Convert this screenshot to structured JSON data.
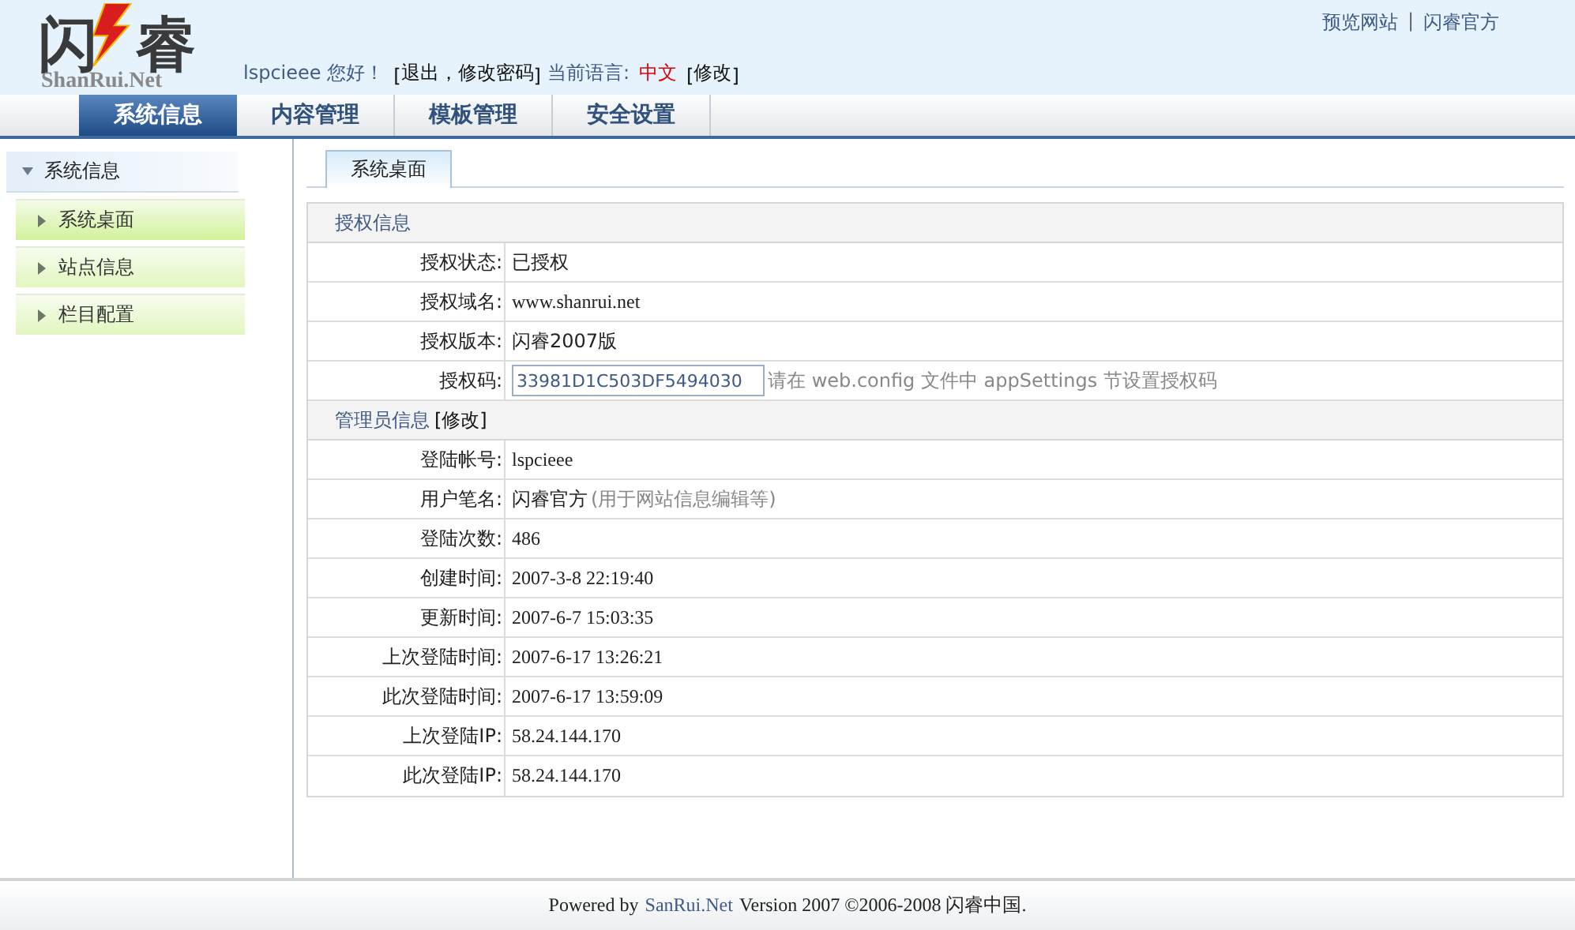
{
  "logo": {
    "mark": "闪睿",
    "caption": "ShanRui.Net"
  },
  "top_links": [
    {
      "kind": "link",
      "text": "预览网站"
    },
    {
      "kind": "sep",
      "text": "|"
    },
    {
      "kind": "link",
      "text": "闪睿官方"
    }
  ],
  "user_bar": [
    {
      "kind": "text",
      "text": "lspcieee 您好！"
    },
    {
      "kind": "plain",
      "text": "["
    },
    {
      "kind": "link",
      "text": "退出"
    },
    {
      "kind": "plain",
      "text": "，"
    },
    {
      "kind": "link",
      "text": "修改密码"
    },
    {
      "kind": "plain",
      "text": "]"
    },
    {
      "kind": "text",
      "text": "当前语言:"
    },
    {
      "kind": "lang",
      "text": "中文"
    },
    {
      "kind": "plain",
      "text": "["
    },
    {
      "kind": "link",
      "text": "修改"
    },
    {
      "kind": "plain",
      "text": "]"
    }
  ],
  "nav_tabs": [
    {
      "label": "系统信息",
      "selected": true
    },
    {
      "label": "内容管理",
      "selected": false
    },
    {
      "label": "模板管理",
      "selected": false
    },
    {
      "label": "安全设置",
      "selected": false
    }
  ],
  "sidebar": {
    "title": "系统信息",
    "expanded": true,
    "items": [
      {
        "label": "系统桌面",
        "selected": true
      },
      {
        "label": "站点信息",
        "selected": false
      },
      {
        "label": "栏目配置",
        "selected": false
      }
    ]
  },
  "content_tabs": [
    {
      "label": "系统桌面",
      "selected": true
    }
  ],
  "sections": [
    {
      "title": "授权信息",
      "rows": [
        {
          "kind": "text",
          "label": "授权状态:",
          "value": "已授权"
        },
        {
          "kind": "text",
          "label": "授权域名:",
          "value": "www.shanrui.net"
        },
        {
          "kind": "text",
          "label": "授权版本:",
          "value": "闪睿2007版"
        },
        {
          "kind": "input",
          "label": "授权码:",
          "value": "33981D1C503DF5494030",
          "note": "请在 web.config 文件中 appSettings 节设置授权码"
        }
      ]
    },
    {
      "title": "管理员信息",
      "link": "[修改]",
      "rows": [
        {
          "kind": "text",
          "label": "登陆帐号:",
          "value": "lspcieee"
        },
        {
          "kind": "text",
          "label": "用户笔名:",
          "value": "闪睿官方",
          "note": "(用于网站信息编辑等)"
        },
        {
          "kind": "text",
          "label": "登陆次数:",
          "value": "486"
        },
        {
          "kind": "text",
          "label": "创建时间:",
          "value": "2007-3-8 22:19:40"
        },
        {
          "kind": "text",
          "label": "更新时间:",
          "value": "2007-6-7 15:03:35"
        },
        {
          "kind": "text",
          "label": "上次登陆时间:",
          "value": "2007-6-17 13:26:21"
        },
        {
          "kind": "text",
          "label": "此次登陆时间:",
          "value": "2007-6-17 13:59:09"
        },
        {
          "kind": "text",
          "label": "上次登陆IP:",
          "value": "58.24.144.170"
        },
        {
          "kind": "text",
          "label": "此次登陆IP:",
          "value": "58.24.144.170"
        }
      ]
    }
  ],
  "footer": [
    {
      "kind": "text",
      "text": "Powered by"
    },
    {
      "kind": "link",
      "text": "SanRui.Net"
    },
    {
      "kind": "text",
      "text": "Version 2007 ©2006-2008 闪睿中国."
    }
  ]
}
